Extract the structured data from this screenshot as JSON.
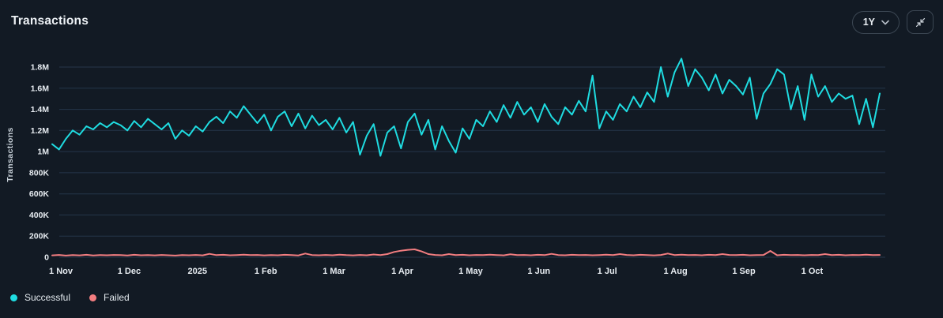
{
  "header": {
    "title": "Transactions",
    "range_selector": {
      "value": "1Y"
    },
    "collapse_button": "collapse"
  },
  "legend": {
    "items": [
      {
        "label": "Successful",
        "color": "#1fdce1"
      },
      {
        "label": "Failed",
        "color": "#f27d80"
      }
    ]
  },
  "colors": {
    "background": "#121a24",
    "gridline": "rgba(103,156,211,0.22)",
    "tick_text": "#e7ecf1",
    "axis_title_text": "#c9d2da",
    "button_border": "#3b4652",
    "successful": "#1fdce1",
    "failed": "#f27d80"
  },
  "chart_data": {
    "type": "line",
    "title": "Transactions",
    "xlabel": "",
    "ylabel": "Transactions",
    "x_unit": "day (1 year span, Nov 2024 - Oct 2025)",
    "y_unit": "transactions (values stored in millions)",
    "ylim": [
      0,
      1900000
    ],
    "grid": "horizontal",
    "legend_position": "bottom-left",
    "x_ticks": [
      "1 Nov",
      "1 Dec",
      "2025",
      "1 Feb",
      "1 Mar",
      "1 Apr",
      "1 May",
      "1 Jun",
      "1 Jul",
      "1 Aug",
      "1 Sep",
      "1 Oct"
    ],
    "y_ticks": [
      {
        "label": "0",
        "value_m": 0
      },
      {
        "label": "200K",
        "value_m": 0.2
      },
      {
        "label": "400K",
        "value_m": 0.4
      },
      {
        "label": "600K",
        "value_m": 0.6
      },
      {
        "label": "800K",
        "value_m": 0.8
      },
      {
        "label": "1M",
        "value_m": 1.0
      },
      {
        "label": "1.2M",
        "value_m": 1.2
      },
      {
        "label": "1.4M",
        "value_m": 1.4
      },
      {
        "label": "1.6M",
        "value_m": 1.6
      },
      {
        "label": "1.8M",
        "value_m": 1.8
      }
    ],
    "series": [
      {
        "name": "Successful",
        "color": "#1fdce1",
        "values_millions": [
          1.07,
          1.02,
          1.12,
          1.2,
          1.16,
          1.24,
          1.21,
          1.27,
          1.23,
          1.28,
          1.25,
          1.2,
          1.29,
          1.23,
          1.31,
          1.26,
          1.21,
          1.27,
          1.12,
          1.2,
          1.15,
          1.24,
          1.19,
          1.28,
          1.33,
          1.27,
          1.38,
          1.32,
          1.43,
          1.35,
          1.27,
          1.35,
          1.2,
          1.33,
          1.38,
          1.24,
          1.36,
          1.22,
          1.34,
          1.25,
          1.3,
          1.21,
          1.32,
          1.18,
          1.28,
          0.97,
          1.15,
          1.26,
          0.96,
          1.18,
          1.24,
          1.03,
          1.28,
          1.36,
          1.16,
          1.3,
          1.02,
          1.24,
          1.1,
          0.99,
          1.22,
          1.12,
          1.3,
          1.24,
          1.38,
          1.28,
          1.44,
          1.32,
          1.47,
          1.35,
          1.42,
          1.28,
          1.45,
          1.33,
          1.26,
          1.42,
          1.35,
          1.48,
          1.38,
          1.72,
          1.22,
          1.38,
          1.3,
          1.45,
          1.38,
          1.52,
          1.42,
          1.56,
          1.47,
          1.8,
          1.52,
          1.75,
          1.88,
          1.62,
          1.78,
          1.7,
          1.58,
          1.73,
          1.55,
          1.68,
          1.62,
          1.54,
          1.7,
          1.31,
          1.55,
          1.64,
          1.78,
          1.73,
          1.4,
          1.62,
          1.3,
          1.73,
          1.52,
          1.62,
          1.47,
          1.55,
          1.5,
          1.53,
          1.26,
          1.5,
          1.23,
          1.55
        ]
      },
      {
        "name": "Failed",
        "color": "#f27d80",
        "values_millions": [
          0.018,
          0.022,
          0.016,
          0.02,
          0.018,
          0.023,
          0.017,
          0.021,
          0.019,
          0.022,
          0.02,
          0.017,
          0.023,
          0.019,
          0.021,
          0.018,
          0.022,
          0.019,
          0.016,
          0.021,
          0.019,
          0.022,
          0.018,
          0.032,
          0.02,
          0.023,
          0.019,
          0.021,
          0.024,
          0.02,
          0.022,
          0.018,
          0.021,
          0.019,
          0.023,
          0.02,
          0.017,
          0.035,
          0.021,
          0.019,
          0.022,
          0.019,
          0.024,
          0.02,
          0.018,
          0.022,
          0.019,
          0.026,
          0.021,
          0.03,
          0.05,
          0.062,
          0.07,
          0.075,
          0.055,
          0.03,
          0.022,
          0.019,
          0.03,
          0.021,
          0.023,
          0.019,
          0.022,
          0.02,
          0.024,
          0.021,
          0.018,
          0.028,
          0.02,
          0.022,
          0.019,
          0.023,
          0.02,
          0.032,
          0.021,
          0.019,
          0.023,
          0.02,
          0.022,
          0.019,
          0.021,
          0.024,
          0.02,
          0.03,
          0.022,
          0.019,
          0.023,
          0.021,
          0.018,
          0.022,
          0.035,
          0.021,
          0.024,
          0.02,
          0.022,
          0.019,
          0.023,
          0.02,
          0.03,
          0.022,
          0.02,
          0.023,
          0.019,
          0.021,
          0.022,
          0.06,
          0.019,
          0.023,
          0.02,
          0.022,
          0.019,
          0.022,
          0.02,
          0.03,
          0.021,
          0.023,
          0.019,
          0.022,
          0.02,
          0.024,
          0.021,
          0.022
        ]
      }
    ]
  }
}
